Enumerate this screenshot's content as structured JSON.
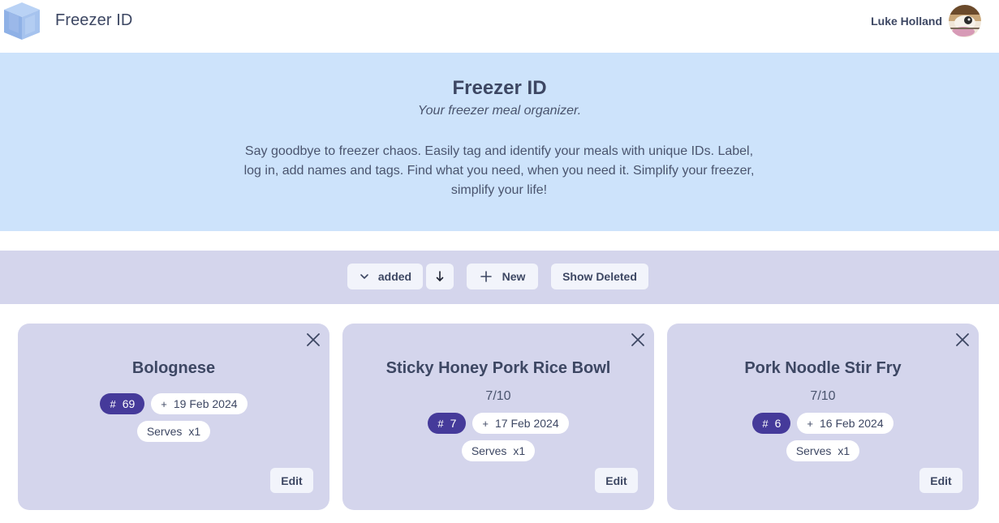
{
  "header": {
    "app_title": "Freezer ID",
    "user_name": "Luke Holland"
  },
  "hero": {
    "title": "Freezer ID",
    "subtitle": "Your freezer meal organizer.",
    "description": "Say goodbye to freezer chaos. Easily tag and identify your meals with unique IDs. Label, log in, add names and tags. Find what you need, when you need it. Simplify your freezer, simplify your life!"
  },
  "toolbar": {
    "sort_label": "added",
    "new_label": "New",
    "show_deleted_label": "Show Deleted"
  },
  "meals": [
    {
      "name": "Bolognese",
      "rating": "",
      "id": "69",
      "date": "19 Feb 2024",
      "serves_label": "Serves",
      "serves_value": "x1",
      "edit_label": "Edit"
    },
    {
      "name": "Sticky Honey Pork Rice Bowl",
      "rating": "7/10",
      "id": "7",
      "date": "17 Feb 2024",
      "serves_label": "Serves",
      "serves_value": "x1",
      "edit_label": "Edit"
    },
    {
      "name": "Pork Noodle Stir Fry",
      "rating": "7/10",
      "id": "6",
      "date": "16 Feb 2024",
      "serves_label": "Serves",
      "serves_value": "x1",
      "edit_label": "Edit"
    }
  ],
  "icons": {
    "logo": "ice-cube-icon",
    "sort": "chevron-down-icon",
    "direction": "arrow-down-icon",
    "new": "plus-icon",
    "close": "close-icon",
    "id": "hash-icon",
    "date": "plus-icon"
  },
  "colors": {
    "hero_bg": "#cde3fb",
    "toolbar_bg": "#d4d5ec",
    "card_bg": "#d4d5ec",
    "id_chip": "#453a9a",
    "text": "#3d4763"
  }
}
